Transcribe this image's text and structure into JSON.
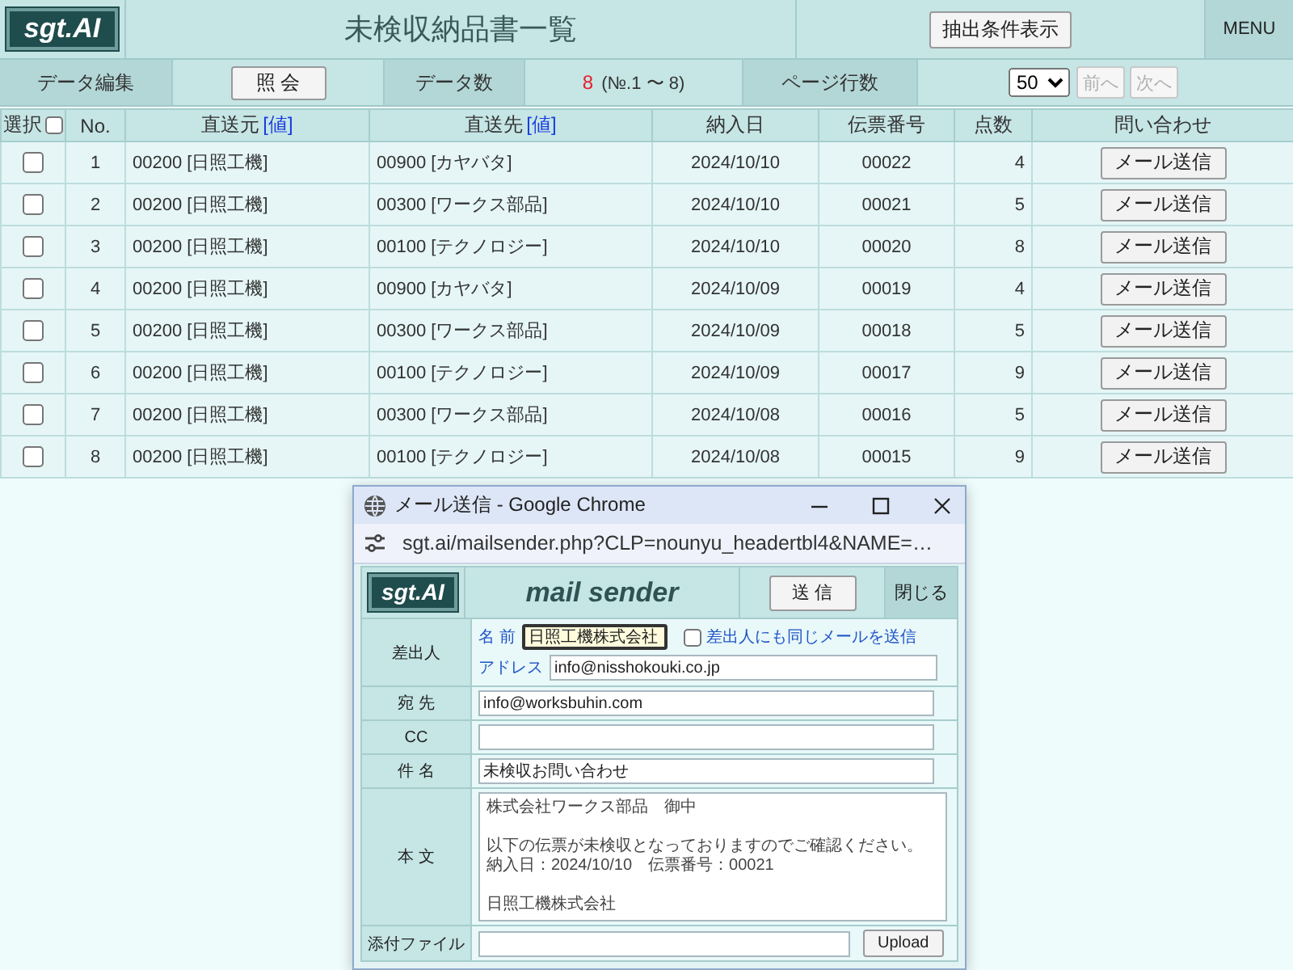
{
  "header": {
    "logo": "sgt.AI",
    "title": "未検収納品書一覧",
    "filter_button": "抽出条件表示",
    "menu": "MENU"
  },
  "toolbar": {
    "edit_label": "データ編集",
    "query_button": "照 会",
    "count_label": "データ数",
    "count": "8",
    "count_range": "(№.1 〜 8)",
    "page_rows_label": "ページ行数",
    "page_rows": "50",
    "pager": [
      {
        "label": "前へ",
        "disabled": true
      },
      {
        "label": "次へ",
        "disabled": true
      }
    ]
  },
  "table": {
    "columns": [
      {
        "label": "選択",
        "checked": false
      },
      {
        "label": "No."
      },
      {
        "label": "直送元",
        "link": "[値]"
      },
      {
        "label": "直送先",
        "link": "[値]"
      },
      {
        "label": "納入日"
      },
      {
        "label": "伝票番号"
      },
      {
        "label": "点数"
      },
      {
        "label": "問い合わせ"
      }
    ],
    "rows": [
      {
        "checked": false,
        "no": "1",
        "sender": "00200 [日照工機]",
        "destination": "00900 [カヤバタ]",
        "date": "2024/10/10",
        "slip_no": "00022",
        "quantity": "4",
        "action": "メール送信"
      },
      {
        "checked": false,
        "no": "2",
        "sender": "00200 [日照工機]",
        "destination": "00300 [ワークス部品]",
        "date": "2024/10/10",
        "slip_no": "00021",
        "quantity": "5",
        "action": "メール送信"
      },
      {
        "checked": false,
        "no": "3",
        "sender": "00200 [日照工機]",
        "destination": "00100 [テクノロジー]",
        "date": "2024/10/10",
        "slip_no": "00020",
        "quantity": "8",
        "action": "メール送信"
      },
      {
        "checked": false,
        "no": "4",
        "sender": "00200 [日照工機]",
        "destination": "00900 [カヤバタ]",
        "date": "2024/10/09",
        "slip_no": "00019",
        "quantity": "4",
        "action": "メール送信"
      },
      {
        "checked": false,
        "no": "5",
        "sender": "00200 [日照工機]",
        "destination": "00300 [ワークス部品]",
        "date": "2024/10/09",
        "slip_no": "00018",
        "quantity": "5",
        "action": "メール送信"
      },
      {
        "checked": false,
        "no": "6",
        "sender": "00200 [日照工機]",
        "destination": "00100 [テクノロジー]",
        "date": "2024/10/09",
        "slip_no": "00017",
        "quantity": "9",
        "action": "メール送信"
      },
      {
        "checked": false,
        "no": "7",
        "sender": "00200 [日照工機]",
        "destination": "00300 [ワークス部品]",
        "date": "2024/10/08",
        "slip_no": "00016",
        "quantity": "5",
        "action": "メール送信"
      },
      {
        "checked": false,
        "no": "8",
        "sender": "00200 [日照工機]",
        "destination": "00100 [テクノロジー]",
        "date": "2024/10/08",
        "slip_no": "00015",
        "quantity": "9",
        "action": "メール送信"
      }
    ]
  },
  "popup": {
    "window_title": "メール送信 - Google Chrome",
    "url": "sgt.ai/mailsender.php?CLP=nounyu_headertbl4&NAME=…",
    "logo": "sgt.AI",
    "heading": "mail sender",
    "send_button": "送 信",
    "close_button": "閉じる",
    "sender": {
      "label": "差出人",
      "name_label": "名 前",
      "name": "日照工機株式会社",
      "name_focused": true,
      "copy_to_self": {
        "label": "差出人にも同じメールを送信",
        "checked": false
      },
      "address_label": "アドレス",
      "address": "info@nisshokouki.co.jp"
    },
    "fields": [
      {
        "kind": "text",
        "label": "宛 先",
        "value": "info@worksbuhin.com"
      },
      {
        "kind": "text",
        "label": "CC"
      },
      {
        "kind": "text",
        "label": "件 名",
        "value": "未検収お問い合わせ"
      },
      {
        "kind": "textarea",
        "label": "本 文",
        "paragraphs": [
          [
            "株式会社ワークス部品　御中"
          ],
          [
            "以下の伝票が未検収となっておりますのでご確認ください。",
            "納入日：2024/10/10　伝票番号：00021"
          ],
          [
            "日照工機株式会社"
          ]
        ]
      },
      {
        "kind": "file",
        "label": "添付ファイル",
        "button": "Upload"
      }
    ]
  }
}
